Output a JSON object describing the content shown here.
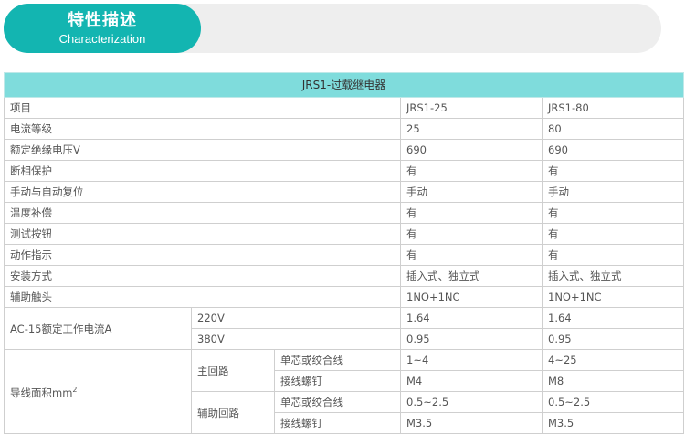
{
  "header": {
    "title_cn": "特性描述",
    "title_en": "Characterization"
  },
  "table": {
    "title": "JRS1-过载继电器",
    "rows": [
      {
        "label": "项目",
        "a": "JRS1-25",
        "b": "JRS1-80"
      },
      {
        "label": "电流等级",
        "a": "25",
        "b": "80"
      },
      {
        "label": "额定绝缘电压V",
        "a": "690",
        "b": "690"
      },
      {
        "label": "断相保护",
        "a": "有",
        "b": "有"
      },
      {
        "label": "手动与自动复位",
        "a": "手动",
        "b": "手动"
      },
      {
        "label": "温度补偿",
        "a": "有",
        "b": "有"
      },
      {
        "label": "测试按钮",
        "a": "有",
        "b": "有"
      },
      {
        "label": "动作指示",
        "a": "有",
        "b": "有"
      },
      {
        "label": "安装方式",
        "a": "插入式、独立式",
        "b": "插入式、独立式"
      },
      {
        "label": "辅助触头",
        "a": "1NO+1NC",
        "b": "1NO+1NC"
      }
    ],
    "ac15": {
      "label": "AC-15额定工作电流A",
      "rows": [
        {
          "voltage": "220V",
          "a": "1.64",
          "b": "1.64"
        },
        {
          "voltage": "380V",
          "a": "0.95",
          "b": "0.95"
        }
      ]
    },
    "wire": {
      "label": "导线面积mm",
      "label_sup": "2",
      "main": {
        "label": "主回路",
        "rows": [
          {
            "type": "单芯或绞合线",
            "a": "1~4",
            "b": "4~25"
          },
          {
            "type": "接线螺钉",
            "a": "M4",
            "b": "M8"
          }
        ]
      },
      "aux": {
        "label": "辅助回路",
        "rows": [
          {
            "type": "单芯或绞合线",
            "a": "0.5~2.5",
            "b": "0.5~2.5"
          },
          {
            "type": "接线螺钉",
            "a": "M3.5",
            "b": "M3.5"
          }
        ]
      }
    }
  }
}
